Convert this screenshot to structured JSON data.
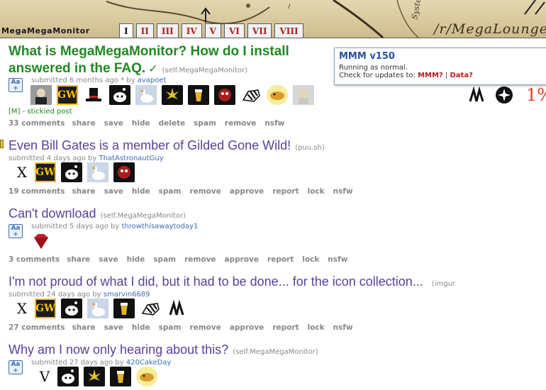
{
  "header": {
    "site_name": "MegaMegaMonitor",
    "subreddit_title": "/r/MegaLounge",
    "tabs": [
      "I",
      "II",
      "III",
      "IV",
      "V",
      "VI",
      "VII",
      "VIII"
    ],
    "active_tab_index": 0
  },
  "popup": {
    "title": "MMM v150",
    "status": "Running as normal.",
    "check_prefix": "Check for updates to:",
    "link_mmm": "MMM?",
    "separator": "|",
    "link_data": "Data?",
    "percent": "1%"
  },
  "posts": [
    {
      "title_line1": "What is MegaMegaMonitor? How do I install",
      "title_line2": "answered in the FAQ.",
      "check": "✓",
      "domain": "(self.MegaMegaMonitor)",
      "flair": "Aa",
      "submitted": "submitted 6 months ago * by",
      "author": "avapoet",
      "stickied": "[M] - stickied post",
      "buttons": [
        "33 comments",
        "share",
        "save",
        "hide",
        "delete",
        "spam",
        "remove",
        "nsfw"
      ]
    },
    {
      "title": "Even Bill Gates is a member of Gilded Gone Wild!",
      "domain": "(puu.sh)",
      "submitted": "submitted 4 days ago by",
      "author": "ThatAstronautGuy",
      "buttons": [
        "19 comments",
        "share",
        "save",
        "hide",
        "spam",
        "remove",
        "approve",
        "report",
        "lock",
        "nsfw"
      ]
    },
    {
      "title": "Can't download",
      "domain": "(self.MegaMegaMonitor)",
      "flair": "Aa",
      "submitted": "submitted 5 days ago by",
      "author": "throwthisawaytoday1",
      "buttons": [
        "3 comments",
        "share",
        "save",
        "hide",
        "spam",
        "remove",
        "approve",
        "report",
        "lock",
        "nsfw"
      ]
    },
    {
      "title": "I'm not proud of what I did, but it had to be done... for the icon collection...",
      "domain": "(imgur.",
      "submitted": "submitted 24 days ago by",
      "author": "smarvin6689",
      "buttons": [
        "27 comments",
        "share",
        "save",
        "hide",
        "spam",
        "remove",
        "approve",
        "report",
        "lock",
        "nsfw"
      ]
    },
    {
      "title": "Why am I now only hearing about this?",
      "domain": "(self.MegaMegaMonitor)",
      "flair": "Aa",
      "submitted": "submitted 27 days ago by",
      "author": "420CakeDay"
    }
  ],
  "icon_letters": {
    "x": "X",
    "v": "V",
    "gw": "GW"
  },
  "colors": {
    "sticky_title": "#228822",
    "post_title": "#5b3f98",
    "link_red": "#b41e1e",
    "author_blue": "#3a6fb5"
  }
}
